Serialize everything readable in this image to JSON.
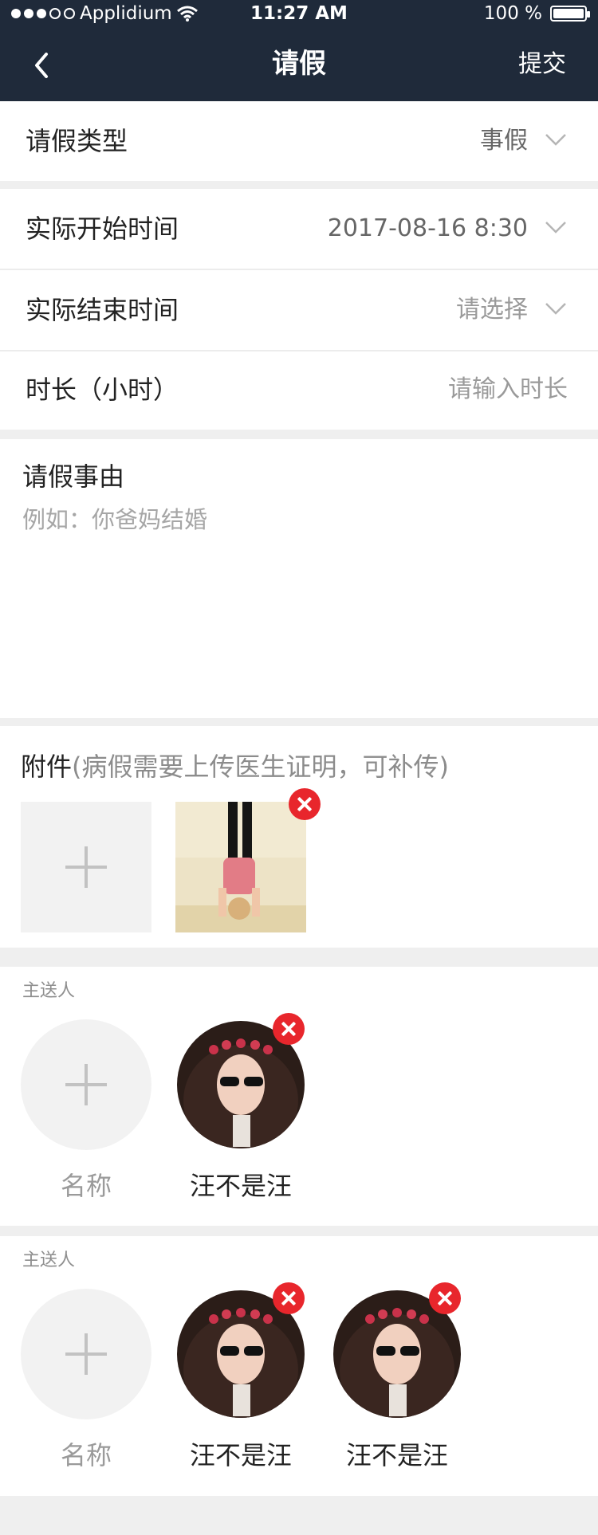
{
  "status_bar": {
    "carrier": "Applidium",
    "time": "11:27 AM",
    "battery": "100 %"
  },
  "nav": {
    "title": "请假",
    "submit_label": "提交"
  },
  "form": {
    "leave_type": {
      "label": "请假类型",
      "value": "事假"
    },
    "start_time": {
      "label": "实际开始时间",
      "value": "2017-08-16 8:30"
    },
    "end_time": {
      "label": "实际结束时间",
      "value": "请选择"
    },
    "duration": {
      "label": "时长（小时）",
      "placeholder": "请输入时长"
    },
    "reason": {
      "label": "请假事由",
      "placeholder": "例如：你爸妈结婚"
    }
  },
  "attachments": {
    "title": "附件",
    "subtitle": "(病假需要上传医生证明，可补传)"
  },
  "recipients_1": {
    "label": "主送人",
    "add_label": "名称",
    "people": [
      {
        "name": "汪不是汪"
      }
    ]
  },
  "recipients_2": {
    "label": "主送人",
    "add_label": "名称",
    "people": [
      {
        "name": "汪不是汪"
      },
      {
        "name": "汪不是汪"
      }
    ]
  },
  "colors": {
    "header_bg": "#1f2a3a",
    "remove_badge": "#e8262c"
  }
}
